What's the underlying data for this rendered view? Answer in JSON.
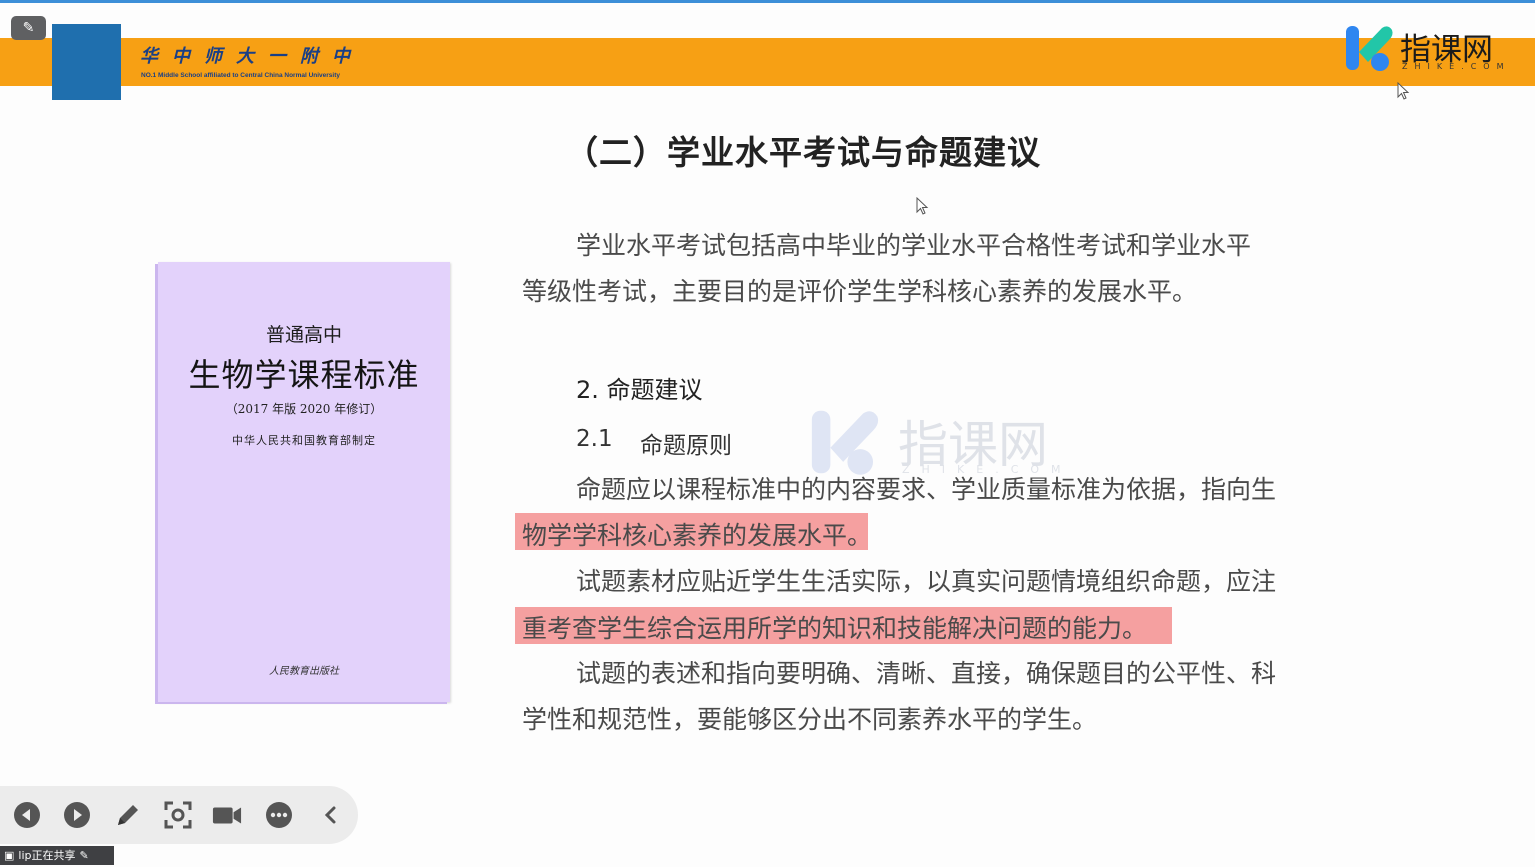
{
  "header": {
    "school_name_cn": "华中师大一附中",
    "school_name_en": "NO.1 Middle School affiliated to Central China Normal University",
    "tool_chip_icon": "whiteboard-icon",
    "brand_logo_text": "指课网",
    "brand_logo_sub": "ZHIKE.COM"
  },
  "slide": {
    "title": "（二）学业水平考试与命题建议",
    "book": {
      "subtitle": "普通高中",
      "title": "生物学课程标准",
      "edition": "（2017 年版 2020 年修订）",
      "org": "中华人民共和国教育部制定",
      "publisher": "人民教育出版社"
    },
    "intro_line1": "学业水平考试包括高中毕业的学业水平合格性考试和学业水平",
    "intro_line2": "等级性考试，主要目的是评价学生学科核心素养的发展水平。",
    "section_heading": "2.  命题建议",
    "subsection_number": "2.1",
    "subsection_title": "命题原则",
    "p1_line1": "命题应以课程标准中的内容要求、学业质量标准为依据，指向生",
    "p1_line2": "物学学科核心素养的发展水平。",
    "p2_line1": "试题素材应贴近学生生活实际，以真实问题情境组织命题，应注",
    "p2_line2": "重考查学生综合运用所学的知识和技能解决问题的能力。",
    "p3_line1": "试题的表述和指向要明确、清晰、直接，确保题目的公平性、科",
    "p3_line2": "学性和规范性，要能够区分出不同素养水平的学生。",
    "watermark_text": "指课网",
    "watermark_sub": "ZHIKE.COM"
  },
  "toolbar": {
    "buttons": [
      "prev-icon",
      "next-icon",
      "pen-icon",
      "screenshot-icon",
      "camera-icon",
      "more-icon",
      "collapse-icon"
    ]
  },
  "share_status": {
    "text": "lip正在共享"
  },
  "colors": {
    "banner": "#f7a014",
    "highlight": "#f5a0a0",
    "book_cover": "#e3d2fb"
  }
}
